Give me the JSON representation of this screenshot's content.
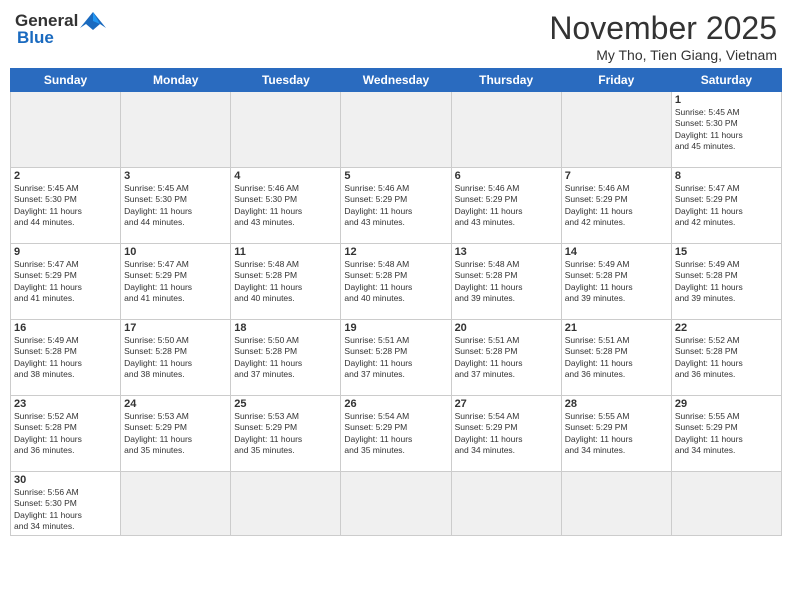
{
  "header": {
    "logo_general": "General",
    "logo_blue": "Blue",
    "month_title": "November 2025",
    "location": "My Tho, Tien Giang, Vietnam"
  },
  "days_of_week": [
    "Sunday",
    "Monday",
    "Tuesday",
    "Wednesday",
    "Thursday",
    "Friday",
    "Saturday"
  ],
  "weeks": [
    [
      {
        "day": "",
        "empty": true
      },
      {
        "day": "",
        "empty": true
      },
      {
        "day": "",
        "empty": true
      },
      {
        "day": "",
        "empty": true
      },
      {
        "day": "",
        "empty": true
      },
      {
        "day": "",
        "empty": true
      },
      {
        "day": "1",
        "info": "Sunrise: 5:45 AM\nSunset: 5:30 PM\nDaylight: 11 hours\nand 45 minutes."
      }
    ],
    [
      {
        "day": "2",
        "info": "Sunrise: 5:45 AM\nSunset: 5:30 PM\nDaylight: 11 hours\nand 44 minutes."
      },
      {
        "day": "3",
        "info": "Sunrise: 5:45 AM\nSunset: 5:30 PM\nDaylight: 11 hours\nand 44 minutes."
      },
      {
        "day": "4",
        "info": "Sunrise: 5:46 AM\nSunset: 5:30 PM\nDaylight: 11 hours\nand 43 minutes."
      },
      {
        "day": "5",
        "info": "Sunrise: 5:46 AM\nSunset: 5:29 PM\nDaylight: 11 hours\nand 43 minutes."
      },
      {
        "day": "6",
        "info": "Sunrise: 5:46 AM\nSunset: 5:29 PM\nDaylight: 11 hours\nand 43 minutes."
      },
      {
        "day": "7",
        "info": "Sunrise: 5:46 AM\nSunset: 5:29 PM\nDaylight: 11 hours\nand 42 minutes."
      },
      {
        "day": "8",
        "info": "Sunrise: 5:47 AM\nSunset: 5:29 PM\nDaylight: 11 hours\nand 42 minutes."
      }
    ],
    [
      {
        "day": "9",
        "info": "Sunrise: 5:47 AM\nSunset: 5:29 PM\nDaylight: 11 hours\nand 41 minutes."
      },
      {
        "day": "10",
        "info": "Sunrise: 5:47 AM\nSunset: 5:29 PM\nDaylight: 11 hours\nand 41 minutes."
      },
      {
        "day": "11",
        "info": "Sunrise: 5:48 AM\nSunset: 5:28 PM\nDaylight: 11 hours\nand 40 minutes."
      },
      {
        "day": "12",
        "info": "Sunrise: 5:48 AM\nSunset: 5:28 PM\nDaylight: 11 hours\nand 40 minutes."
      },
      {
        "day": "13",
        "info": "Sunrise: 5:48 AM\nSunset: 5:28 PM\nDaylight: 11 hours\nand 39 minutes."
      },
      {
        "day": "14",
        "info": "Sunrise: 5:49 AM\nSunset: 5:28 PM\nDaylight: 11 hours\nand 39 minutes."
      },
      {
        "day": "15",
        "info": "Sunrise: 5:49 AM\nSunset: 5:28 PM\nDaylight: 11 hours\nand 39 minutes."
      }
    ],
    [
      {
        "day": "16",
        "info": "Sunrise: 5:49 AM\nSunset: 5:28 PM\nDaylight: 11 hours\nand 38 minutes."
      },
      {
        "day": "17",
        "info": "Sunrise: 5:50 AM\nSunset: 5:28 PM\nDaylight: 11 hours\nand 38 minutes."
      },
      {
        "day": "18",
        "info": "Sunrise: 5:50 AM\nSunset: 5:28 PM\nDaylight: 11 hours\nand 37 minutes."
      },
      {
        "day": "19",
        "info": "Sunrise: 5:51 AM\nSunset: 5:28 PM\nDaylight: 11 hours\nand 37 minutes."
      },
      {
        "day": "20",
        "info": "Sunrise: 5:51 AM\nSunset: 5:28 PM\nDaylight: 11 hours\nand 37 minutes."
      },
      {
        "day": "21",
        "info": "Sunrise: 5:51 AM\nSunset: 5:28 PM\nDaylight: 11 hours\nand 36 minutes."
      },
      {
        "day": "22",
        "info": "Sunrise: 5:52 AM\nSunset: 5:28 PM\nDaylight: 11 hours\nand 36 minutes."
      }
    ],
    [
      {
        "day": "23",
        "info": "Sunrise: 5:52 AM\nSunset: 5:28 PM\nDaylight: 11 hours\nand 36 minutes."
      },
      {
        "day": "24",
        "info": "Sunrise: 5:53 AM\nSunset: 5:29 PM\nDaylight: 11 hours\nand 35 minutes."
      },
      {
        "day": "25",
        "info": "Sunrise: 5:53 AM\nSunset: 5:29 PM\nDaylight: 11 hours\nand 35 minutes."
      },
      {
        "day": "26",
        "info": "Sunrise: 5:54 AM\nSunset: 5:29 PM\nDaylight: 11 hours\nand 35 minutes."
      },
      {
        "day": "27",
        "info": "Sunrise: 5:54 AM\nSunset: 5:29 PM\nDaylight: 11 hours\nand 34 minutes."
      },
      {
        "day": "28",
        "info": "Sunrise: 5:55 AM\nSunset: 5:29 PM\nDaylight: 11 hours\nand 34 minutes."
      },
      {
        "day": "29",
        "info": "Sunrise: 5:55 AM\nSunset: 5:29 PM\nDaylight: 11 hours\nand 34 minutes."
      }
    ],
    [
      {
        "day": "30",
        "info": "Sunrise: 5:56 AM\nSunset: 5:30 PM\nDaylight: 11 hours\nand 34 minutes."
      },
      {
        "day": "",
        "empty": true
      },
      {
        "day": "",
        "empty": true
      },
      {
        "day": "",
        "empty": true
      },
      {
        "day": "",
        "empty": true
      },
      {
        "day": "",
        "empty": true
      },
      {
        "day": "",
        "empty": true
      }
    ]
  ]
}
